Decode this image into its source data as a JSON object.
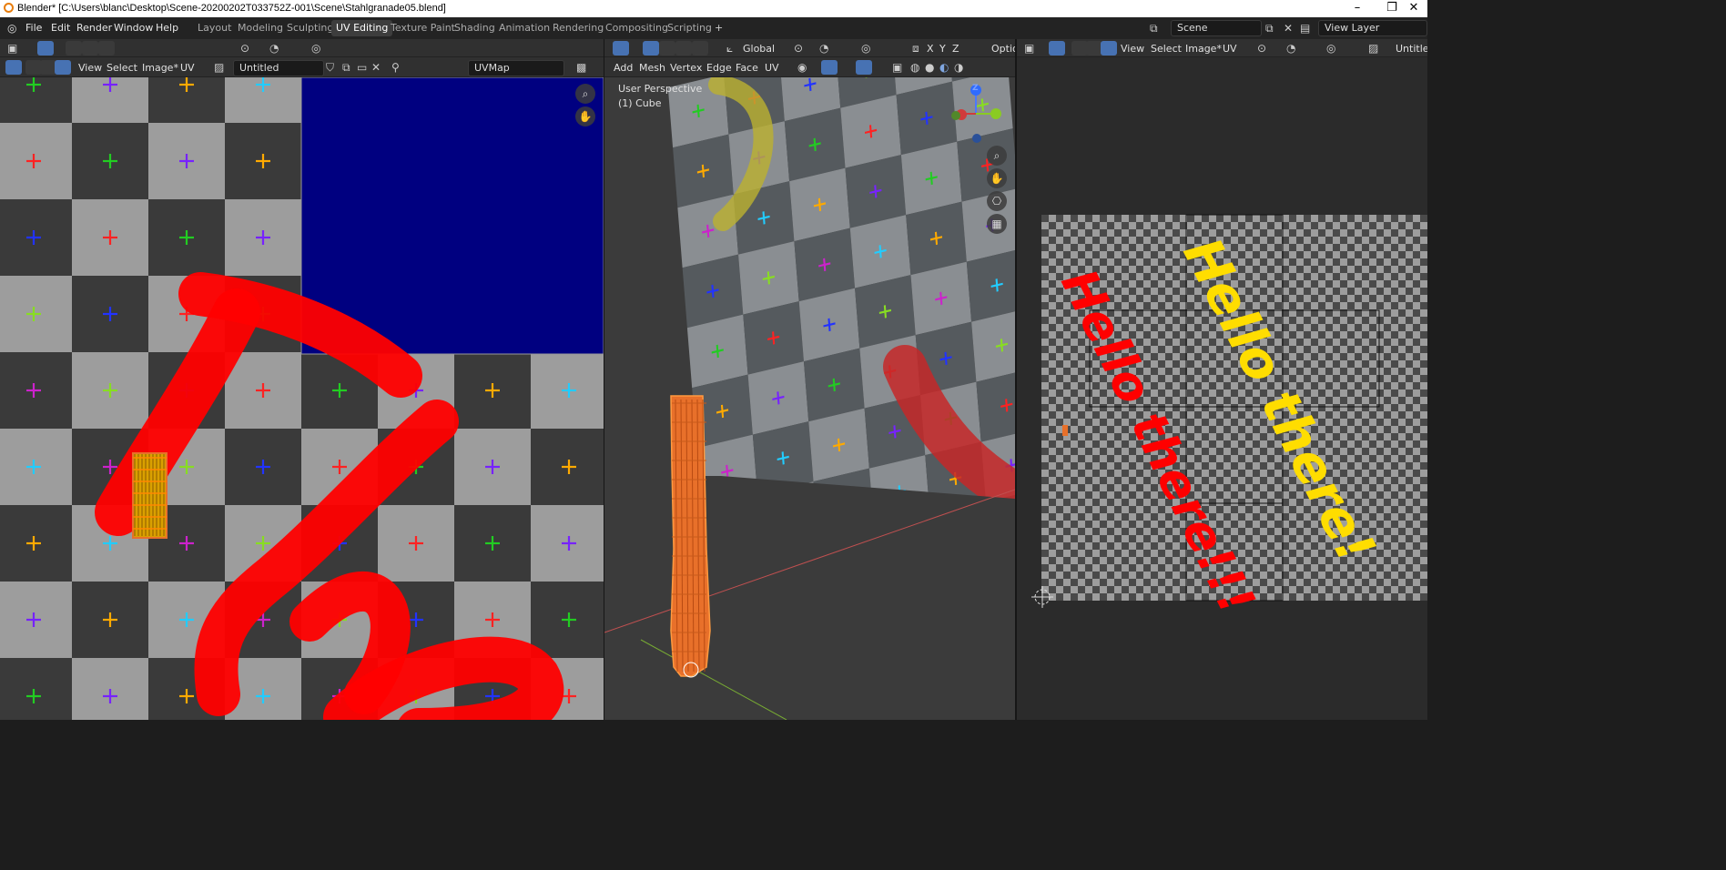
{
  "window": {
    "title": "Blender* [C:\\Users\\blanc\\Desktop\\Scene-20200202T033752Z-001\\Scene\\Stahlgranade05.blend]"
  },
  "menu": [
    "File",
    "Edit",
    "Render",
    "Window",
    "Help"
  ],
  "workspaces": [
    "Layout",
    "Modeling",
    "Sculpting",
    "UV Editing",
    "Texture Paint",
    "Shading",
    "Animation",
    "Rendering",
    "Compositing",
    "Scripting"
  ],
  "active_workspace": "UV Editing",
  "scene": {
    "label": "Scene"
  },
  "view_layer": {
    "label": "View Layer"
  },
  "uv_editor": {
    "menus": [
      "View",
      "Select",
      "Image*",
      "UV"
    ],
    "image_name": "Untitled",
    "uv_map": "UVMap"
  },
  "viewport": {
    "transform_orientation": "Global",
    "axes": [
      "X",
      "Y",
      "Z"
    ],
    "options_label": "Options",
    "menus": [
      "Add",
      "Mesh",
      "Vertex",
      "Edge",
      "Face",
      "UV"
    ],
    "overlay_line1": "User Perspective",
    "overlay_line2": "(1) Cube",
    "gizmo_axis": "Z"
  },
  "image_editor": {
    "menus": [
      "View",
      "Select",
      "Image*",
      "UV"
    ],
    "image_name": "Untitled",
    "painted_text_1": "Hello there!",
    "painted_text_2": "Hello there!!!"
  },
  "colors": {
    "accent": "#4772b3",
    "header": "#303030",
    "blue_patch": "#000080",
    "paint_red": "#ff0000",
    "paint_yellow": "#ffdd00",
    "object_orange": "#e8702a"
  },
  "icons": [
    "blender-logo",
    "editor-type-icon",
    "select-box-icon",
    "zoom-icon",
    "hand-icon",
    "camera-icon",
    "grid-icon",
    "pin-icon",
    "close-icon"
  ]
}
